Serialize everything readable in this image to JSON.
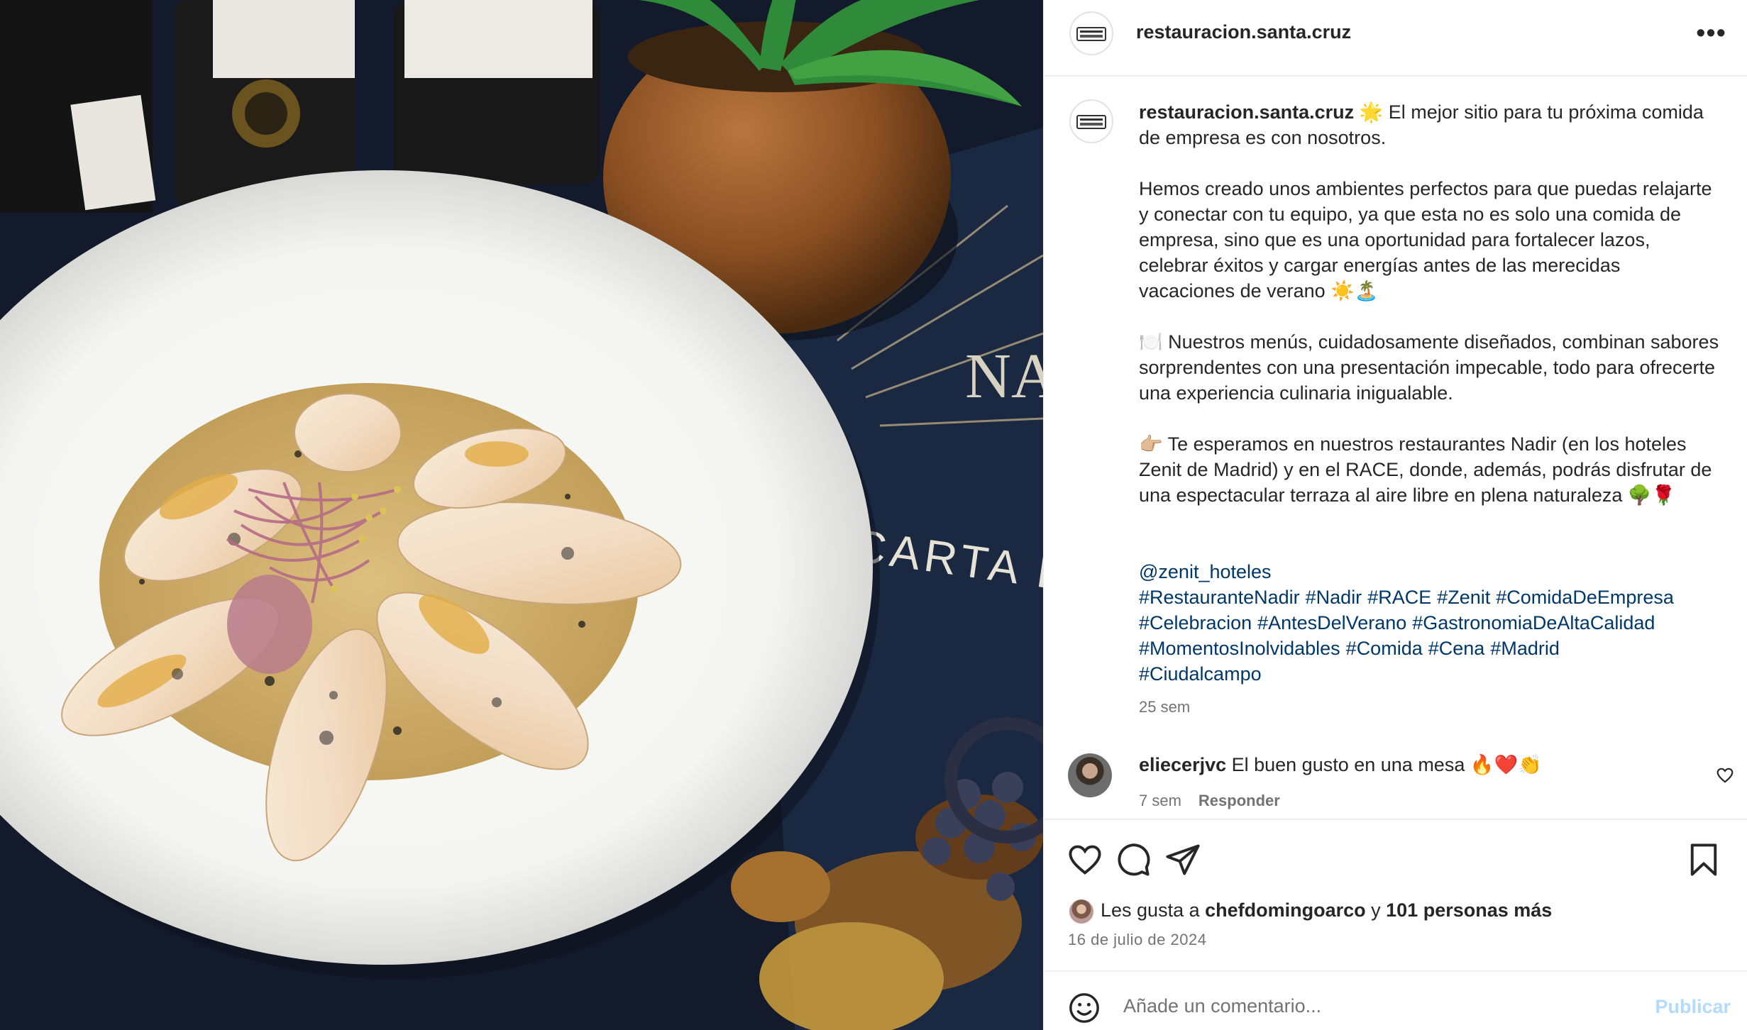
{
  "post": {
    "username": "restauracion.santa.cruz",
    "more_icon": "more-options-icon",
    "caption": {
      "username": "restauracion.santa.cruz",
      "text": " 🌟 El mejor sitio para tu próxima comida de empresa es con nosotros.\n\nHemos creado unos ambientes perfectos para que puedas relajarte y conectar con tu equipo, ya que esta no es solo una comida de empresa, sino que es una oportunidad para fortalecer lazos, celebrar éxitos y cargar energías antes de las merecidas vacaciones de verano ☀️🏝️\n\n🍽️ Nuestros menús, cuidadosamente diseñados, combinan sabores sorprendentes con una presentación impecable, todo para ofrecerte una experiencia culinaria inigualable.\n\n👉🏼 Te esperamos en nuestros restaurantes Nadir (en los hoteles Zenit de Madrid) y en el RACE, donde, además, podrás disfrutar de una espectacular terraza al aire libre en plena naturaleza 🌳🌹"
    },
    "tags": [
      "@zenit_hoteles",
      "#RestauranteNadir",
      "#Nadir",
      "#RACE",
      "#Zenit",
      "#ComidaDeEmpresa",
      "#Celebracion",
      "#AntesDelVerano",
      "#GastronomiaDeAltaCalidad",
      "#MomentosInolvidables",
      "#Comida",
      "#Cena",
      "#Madrid",
      "#Ciudalcampo"
    ],
    "time_ago": "25 sem"
  },
  "comment": {
    "username": "eliecerjvc",
    "text": " El buen gusto en una mesa 🔥❤️👏",
    "time_ago": "7 sem",
    "reply_label": "Responder"
  },
  "likes": {
    "prefix": "Les gusta a ",
    "user": "chefdomingoarco",
    "joiner": " y ",
    "others": "101 personas más"
  },
  "date": "16 de julio de 2024",
  "composer": {
    "placeholder": "Añade un comentario...",
    "publish_label": "Publicar"
  },
  "photo": {
    "menu_text": "CARTA D",
    "menu_brand": "NA"
  },
  "colors": {
    "hashtag": "#00376b",
    "muted": "#737373",
    "publish_disabled": "#b3dbff"
  }
}
